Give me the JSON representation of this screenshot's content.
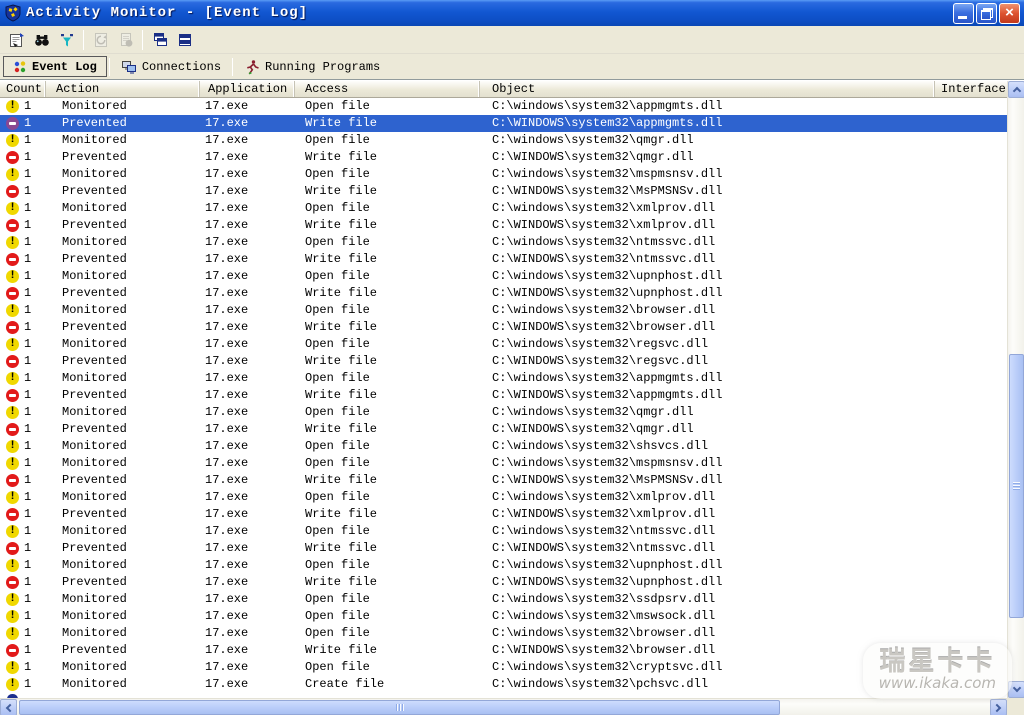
{
  "window": {
    "title": "Activity Monitor - [Event Log]"
  },
  "toolbar": {
    "buttons": [
      {
        "name": "properties",
        "enabled": true
      },
      {
        "name": "find",
        "enabled": true
      },
      {
        "name": "filter",
        "enabled": true
      },
      {
        "name": "refresh",
        "enabled": false
      },
      {
        "name": "report",
        "enabled": false
      },
      {
        "name": "cascade-windows",
        "enabled": true
      },
      {
        "name": "tile-windows",
        "enabled": true
      }
    ]
  },
  "tabs": [
    {
      "label": "Event Log",
      "active": true
    },
    {
      "label": "Connections",
      "active": false
    },
    {
      "label": "Running Programs",
      "active": false
    }
  ],
  "table": {
    "columns": [
      "Count",
      "Action",
      "Application",
      "Access",
      "Object",
      "Interface"
    ],
    "rows": [
      {
        "icon": "monitored",
        "count": "1",
        "action": "Monitored",
        "application": "17.exe",
        "access": "Open file",
        "object": "C:\\windows\\system32\\appmgmts.dll",
        "selected": false
      },
      {
        "icon": "prevented",
        "count": "1",
        "action": "Prevented",
        "application": "17.exe",
        "access": "Write file",
        "object": "C:\\WINDOWS\\system32\\appmgmts.dll",
        "selected": true
      },
      {
        "icon": "monitored",
        "count": "1",
        "action": "Monitored",
        "application": "17.exe",
        "access": "Open file",
        "object": "C:\\windows\\system32\\qmgr.dll",
        "selected": false
      },
      {
        "icon": "prevented",
        "count": "1",
        "action": "Prevented",
        "application": "17.exe",
        "access": "Write file",
        "object": "C:\\WINDOWS\\system32\\qmgr.dll",
        "selected": false
      },
      {
        "icon": "monitored",
        "count": "1",
        "action": "Monitored",
        "application": "17.exe",
        "access": "Open file",
        "object": "C:\\windows\\system32\\mspmsnsv.dll",
        "selected": false
      },
      {
        "icon": "prevented",
        "count": "1",
        "action": "Prevented",
        "application": "17.exe",
        "access": "Write file",
        "object": "C:\\WINDOWS\\system32\\MsPMSNSv.dll",
        "selected": false
      },
      {
        "icon": "monitored",
        "count": "1",
        "action": "Monitored",
        "application": "17.exe",
        "access": "Open file",
        "object": "C:\\windows\\system32\\xmlprov.dll",
        "selected": false
      },
      {
        "icon": "prevented",
        "count": "1",
        "action": "Prevented",
        "application": "17.exe",
        "access": "Write file",
        "object": "C:\\WINDOWS\\system32\\xmlprov.dll",
        "selected": false
      },
      {
        "icon": "monitored",
        "count": "1",
        "action": "Monitored",
        "application": "17.exe",
        "access": "Open file",
        "object": "C:\\windows\\system32\\ntmssvc.dll",
        "selected": false
      },
      {
        "icon": "prevented",
        "count": "1",
        "action": "Prevented",
        "application": "17.exe",
        "access": "Write file",
        "object": "C:\\WINDOWS\\system32\\ntmssvc.dll",
        "selected": false
      },
      {
        "icon": "monitored",
        "count": "1",
        "action": "Monitored",
        "application": "17.exe",
        "access": "Open file",
        "object": "C:\\windows\\system32\\upnphost.dll",
        "selected": false
      },
      {
        "icon": "prevented",
        "count": "1",
        "action": "Prevented",
        "application": "17.exe",
        "access": "Write file",
        "object": "C:\\WINDOWS\\system32\\upnphost.dll",
        "selected": false
      },
      {
        "icon": "monitored",
        "count": "1",
        "action": "Monitored",
        "application": "17.exe",
        "access": "Open file",
        "object": "C:\\windows\\system32\\browser.dll",
        "selected": false
      },
      {
        "icon": "prevented",
        "count": "1",
        "action": "Prevented",
        "application": "17.exe",
        "access": "Write file",
        "object": "C:\\WINDOWS\\system32\\browser.dll",
        "selected": false
      },
      {
        "icon": "monitored",
        "count": "1",
        "action": "Monitored",
        "application": "17.exe",
        "access": "Open file",
        "object": "C:\\windows\\system32\\regsvc.dll",
        "selected": false
      },
      {
        "icon": "prevented",
        "count": "1",
        "action": "Prevented",
        "application": "17.exe",
        "access": "Write file",
        "object": "C:\\WINDOWS\\system32\\regsvc.dll",
        "selected": false
      },
      {
        "icon": "monitored",
        "count": "1",
        "action": "Monitored",
        "application": "17.exe",
        "access": "Open file",
        "object": "C:\\windows\\system32\\appmgmts.dll",
        "selected": false
      },
      {
        "icon": "prevented",
        "count": "1",
        "action": "Prevented",
        "application": "17.exe",
        "access": "Write file",
        "object": "C:\\WINDOWS\\system32\\appmgmts.dll",
        "selected": false
      },
      {
        "icon": "monitored",
        "count": "1",
        "action": "Monitored",
        "application": "17.exe",
        "access": "Open file",
        "object": "C:\\windows\\system32\\qmgr.dll",
        "selected": false
      },
      {
        "icon": "prevented",
        "count": "1",
        "action": "Prevented",
        "application": "17.exe",
        "access": "Write file",
        "object": "C:\\WINDOWS\\system32\\qmgr.dll",
        "selected": false
      },
      {
        "icon": "monitored",
        "count": "1",
        "action": "Monitored",
        "application": "17.exe",
        "access": "Open file",
        "object": "C:\\windows\\system32\\shsvcs.dll",
        "selected": false
      },
      {
        "icon": "monitored",
        "count": "1",
        "action": "Monitored",
        "application": "17.exe",
        "access": "Open file",
        "object": "C:\\windows\\system32\\mspmsnsv.dll",
        "selected": false
      },
      {
        "icon": "prevented",
        "count": "1",
        "action": "Prevented",
        "application": "17.exe",
        "access": "Write file",
        "object": "C:\\WINDOWS\\system32\\MsPMSNSv.dll",
        "selected": false
      },
      {
        "icon": "monitored",
        "count": "1",
        "action": "Monitored",
        "application": "17.exe",
        "access": "Open file",
        "object": "C:\\windows\\system32\\xmlprov.dll",
        "selected": false
      },
      {
        "icon": "prevented",
        "count": "1",
        "action": "Prevented",
        "application": "17.exe",
        "access": "Write file",
        "object": "C:\\WINDOWS\\system32\\xmlprov.dll",
        "selected": false
      },
      {
        "icon": "monitored",
        "count": "1",
        "action": "Monitored",
        "application": "17.exe",
        "access": "Open file",
        "object": "C:\\windows\\system32\\ntmssvc.dll",
        "selected": false
      },
      {
        "icon": "prevented",
        "count": "1",
        "action": "Prevented",
        "application": "17.exe",
        "access": "Write file",
        "object": "C:\\WINDOWS\\system32\\ntmssvc.dll",
        "selected": false
      },
      {
        "icon": "monitored",
        "count": "1",
        "action": "Monitored",
        "application": "17.exe",
        "access": "Open file",
        "object": "C:\\windows\\system32\\upnphost.dll",
        "selected": false
      },
      {
        "icon": "prevented",
        "count": "1",
        "action": "Prevented",
        "application": "17.exe",
        "access": "Write file",
        "object": "C:\\WINDOWS\\system32\\upnphost.dll",
        "selected": false
      },
      {
        "icon": "monitored",
        "count": "1",
        "action": "Monitored",
        "application": "17.exe",
        "access": "Open file",
        "object": "C:\\windows\\system32\\ssdpsrv.dll",
        "selected": false
      },
      {
        "icon": "monitored",
        "count": "1",
        "action": "Monitored",
        "application": "17.exe",
        "access": "Open file",
        "object": "C:\\windows\\system32\\mswsock.dll",
        "selected": false
      },
      {
        "icon": "monitored",
        "count": "1",
        "action": "Monitored",
        "application": "17.exe",
        "access": "Open file",
        "object": "C:\\windows\\system32\\browser.dll",
        "selected": false
      },
      {
        "icon": "prevented",
        "count": "1",
        "action": "Prevented",
        "application": "17.exe",
        "access": "Write file",
        "object": "C:\\WINDOWS\\system32\\browser.dll",
        "selected": false
      },
      {
        "icon": "monitored",
        "count": "1",
        "action": "Monitored",
        "application": "17.exe",
        "access": "Open file",
        "object": "C:\\windows\\system32\\cryptsvc.dll",
        "selected": false
      },
      {
        "icon": "monitored",
        "count": "1",
        "action": "Monitored",
        "application": "17.exe",
        "access": "Create file",
        "object": "C:\\windows\\system32\\pchsvc.dll",
        "selected": false
      }
    ]
  },
  "watermark": {
    "line1": "瑞星卡卡",
    "line2": "www.ikaka.com"
  },
  "colors": {
    "selection_blue": "#2e63cf",
    "monitored_yellow": "#f0d800",
    "prevented_red": "#e21a1a",
    "titlebar_blue": "#1257d2"
  }
}
